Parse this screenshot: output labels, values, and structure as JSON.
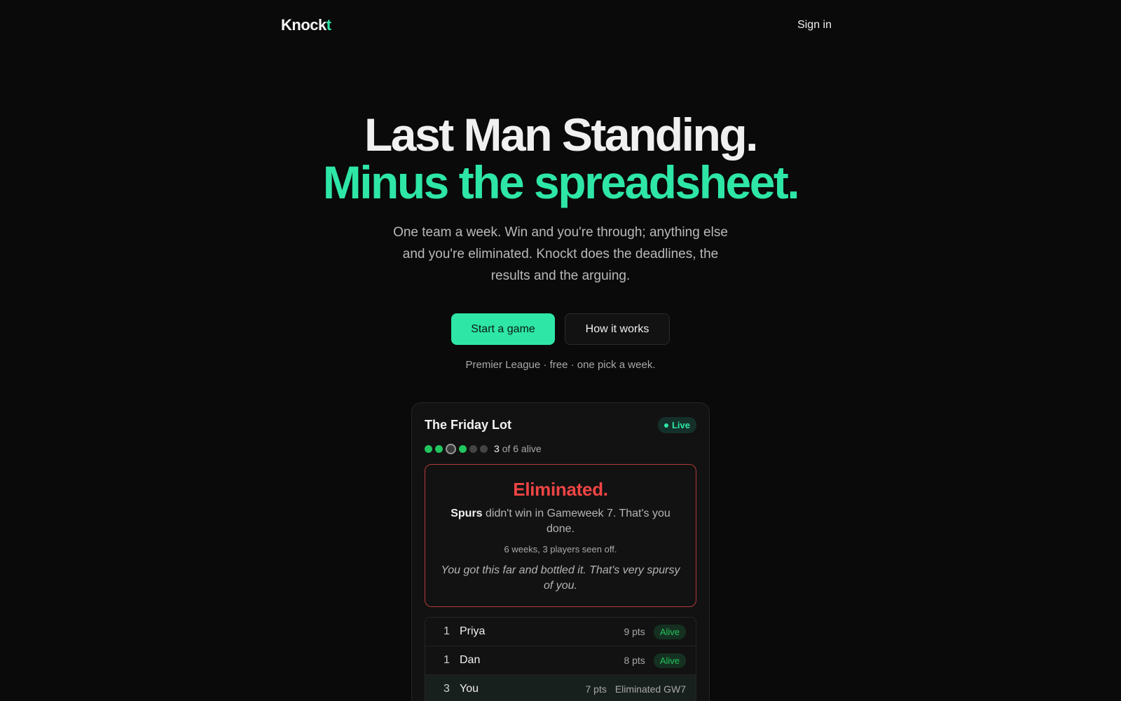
{
  "nav": {
    "logo_main": "Knock",
    "logo_accent": "t",
    "signin": "Sign in"
  },
  "hero": {
    "line1": "Last Man Standing.",
    "line2": "Minus the spreadsheet.",
    "subcopy": "One team a week. Win and you're through; anything else and you're eliminated. Knockt does the deadlines, the results and the arguing.",
    "cta_primary": "Start a game",
    "cta_secondary": "How it works",
    "tagline": "Premier League · free · one pick a week."
  },
  "colors": {
    "accent": "#2ee6a6",
    "danger": "#ef4444",
    "alive": "#22c55e"
  },
  "card": {
    "title": "The Friday Lot",
    "badge": "Live",
    "alive_count": "3",
    "alive_suffix": "of 6 alive",
    "dots": [
      "alive",
      "alive",
      "you",
      "alive",
      "out",
      "out"
    ],
    "elim": {
      "title": "Eliminated.",
      "team": "Spurs",
      "message": "didn't win in Gameweek 7. That's you done.",
      "stat": "6 weeks, 3 players seen off.",
      "quote": "You got this far and bottled it. That's very spursy of you."
    },
    "rows": [
      {
        "rank": "1",
        "name": "Priya",
        "pts": "9 pts",
        "status": "Alive"
      },
      {
        "rank": "1",
        "name": "Dan",
        "pts": "8 pts",
        "status": "Alive"
      },
      {
        "rank": "3",
        "name": "You",
        "pts": "7 pts",
        "status": "Eliminated GW7"
      }
    ]
  }
}
